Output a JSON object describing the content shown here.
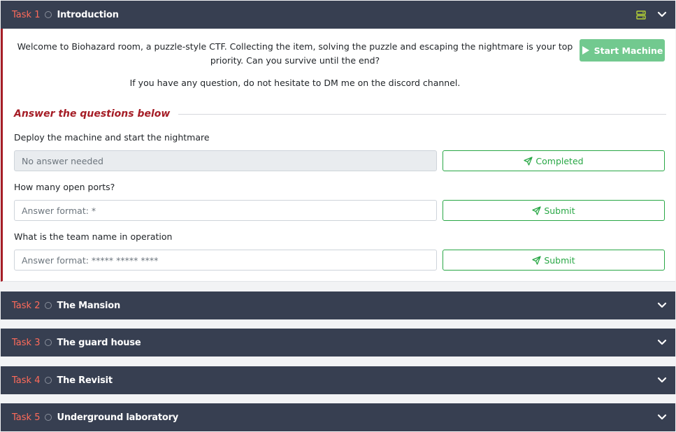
{
  "tasks": [
    {
      "num": "Task 1",
      "title": "Introduction"
    },
    {
      "num": "Task 2",
      "title": "The Mansion"
    },
    {
      "num": "Task 3",
      "title": "The guard house"
    },
    {
      "num": "Task 4",
      "title": "The Revisit"
    },
    {
      "num": "Task 5",
      "title": "Underground laboratory"
    }
  ],
  "intro": {
    "line1": "Welcome to Biohazard room, a puzzle-style CTF. Collecting the item, solving the puzzle and escaping the nightmare is your top priority. Can you survive until the end?",
    "line2": "If you have any question, do not hesitate to DM me on the discord channel."
  },
  "start_machine_label": "Start Machine",
  "questions_header": "Answer the questions below",
  "questions": [
    {
      "label": "Deploy the machine and start the nightmare",
      "placeholder": "No answer needed",
      "button": "Completed"
    },
    {
      "label": "How many open ports?",
      "placeholder": "Answer format: *",
      "button": "Submit"
    },
    {
      "label": "What is the team name in operation",
      "placeholder": "Answer format: ***** ***** ****",
      "button": "Submit"
    }
  ],
  "colors": {
    "header_bg": "#373f51",
    "task_num": "#ff6b5a",
    "accent_red": "#a51d26",
    "success_green": "#28a745",
    "start_button": "#72c98f",
    "list_icon": "#b5d334"
  },
  "icons": {
    "header_list": "server-list-icon",
    "expand": "chevron-down-icon",
    "play": "play-icon",
    "send": "paper-plane-icon"
  }
}
